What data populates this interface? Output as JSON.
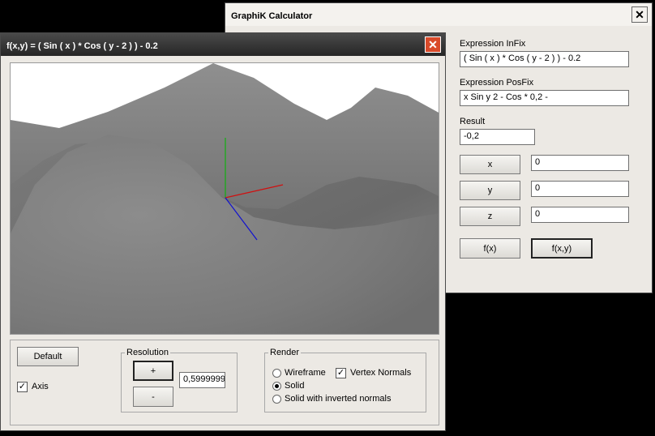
{
  "calc": {
    "title": "GraphiK Calculator",
    "close_glyph": "✕",
    "infix_label": "Expression InFix",
    "infix_value": "( Sin ( x ) * Cos ( y - 2 ) ) - 0.2",
    "posfix_label": "Expression PosFix",
    "posfix_value": " x  Sin  y 2 -  Cos *  0,2 -",
    "result_label": "Result",
    "result_value": "-0,2",
    "x_label": "x",
    "x_value": "0",
    "y_label": "y",
    "y_value": "0",
    "z_label": "z",
    "z_value": "0",
    "fx_label": "f(x)",
    "fxy_label": "f(x,y)"
  },
  "plot": {
    "title": "f(x,y) = ( Sin ( x )  * Cos ( y - 2 ) ) - 0.2",
    "close_glyph": "✕",
    "default_label": "Default",
    "axis_label": "Axis",
    "axis_checked": true,
    "resolution_label": "Resolution",
    "plus_label": "+",
    "minus_label": "-",
    "resolution_value": "0,5999999",
    "render_label": "Render",
    "wireframe_label": "Wireframe",
    "solid_label": "Solid",
    "solid_inverted_label": "Solid with inverted normals",
    "vertex_normals_label": "Vertex Normals",
    "vertex_normals_checked": true,
    "selected_render": "Solid"
  },
  "colors": {
    "axis_x": "#d01010",
    "axis_y": "#10b010",
    "axis_z": "#1010d0",
    "close_button": "#d94a2a"
  }
}
